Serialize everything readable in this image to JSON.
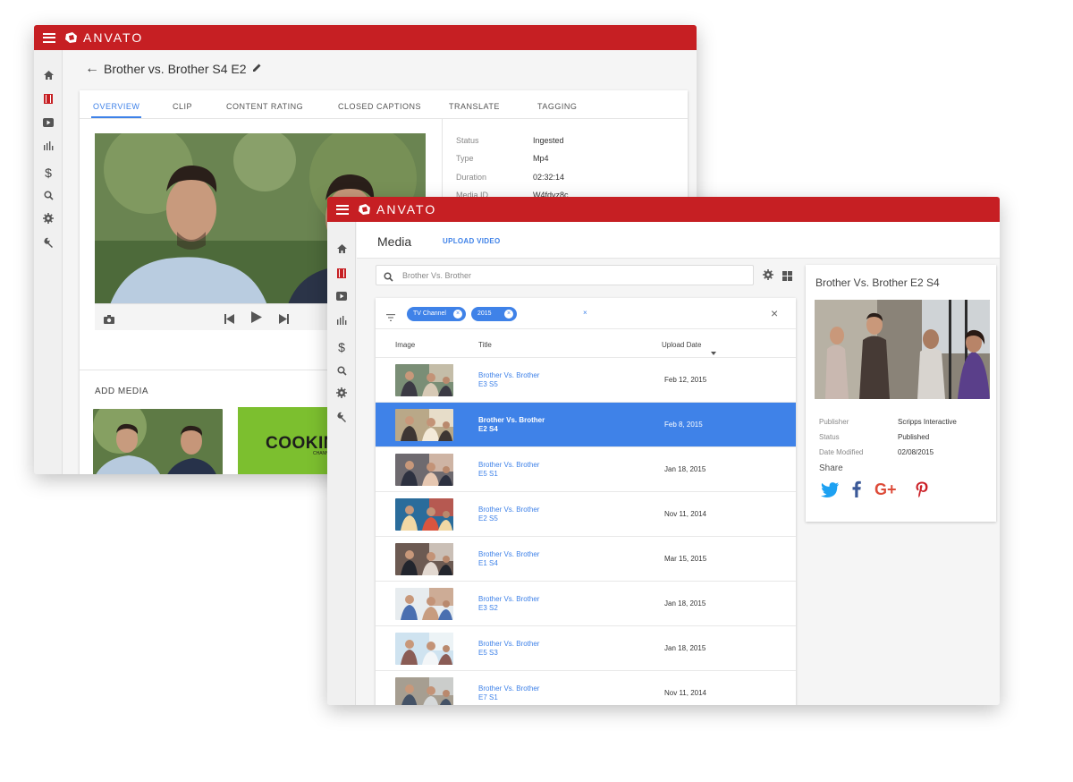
{
  "brand": {
    "name": "ANVATO",
    "color": "#c61f23",
    "accent": "#3f82e8"
  },
  "back_window": {
    "title": "Brother vs. Brother S4 E2",
    "tabs": [
      {
        "label": "OVERVIEW",
        "active": true
      },
      {
        "label": "CLIP"
      },
      {
        "label": "CONTENT RATING"
      },
      {
        "label": "CLOSED CAPTIONS"
      },
      {
        "label": "TRANSLATE"
      },
      {
        "label": "TAGGING"
      }
    ],
    "details": [
      {
        "label": "Status",
        "value": "Ingested"
      },
      {
        "label": "Type",
        "value": "Mp4"
      },
      {
        "label": "Duration",
        "value": "02:32:14"
      },
      {
        "label": "Media ID",
        "value": "W4fdvz8c"
      }
    ],
    "add_media_label": "ADD MEDIA",
    "promo_text": "COOKIN",
    "promo_sub": "CHANN"
  },
  "front_window": {
    "page_title": "Media",
    "upload_label": "UPLOAD VIDEO",
    "search_placeholder": "Brother Vs. Brother",
    "filters": [
      {
        "label": "TV Channel"
      },
      {
        "label": "2015"
      }
    ],
    "columns": {
      "image": "Image",
      "title": "Title",
      "upload_date": "Upload Date"
    },
    "rows": [
      {
        "title_line1": "Brother Vs. Brother",
        "title_line2": "E3 S5",
        "date": "Feb 12, 2015"
      },
      {
        "title_line1": "Brother Vs. Brother",
        "title_line2": "E2 S4",
        "date": "Feb 8, 2015",
        "selected": true
      },
      {
        "title_line1": "Brother Vs. Brother",
        "title_line2": "E5 S1",
        "date": "Jan 18, 2015"
      },
      {
        "title_line1": "Brother Vs. Brother",
        "title_line2": "E2 S5",
        "date": "Nov 11, 2014"
      },
      {
        "title_line1": "Brother Vs. Brother",
        "title_line2": "E1 S4",
        "date": "Mar 15, 2015"
      },
      {
        "title_line1": "Brother Vs. Brother",
        "title_line2": "E3 S2",
        "date": "Jan 18, 2015"
      },
      {
        "title_line1": "Brother Vs. Brother",
        "title_line2": "E5 S3",
        "date": "Jan 18, 2015"
      },
      {
        "title_line1": "Brother Vs. Brother",
        "title_line2": "E7 S1",
        "date": "Nov 11, 2014"
      }
    ],
    "detail": {
      "title": "Brother Vs. Brother E2 S4",
      "fields": [
        {
          "label": "Publisher",
          "value": "Scripps Interactive"
        },
        {
          "label": "Status",
          "value": "Published"
        },
        {
          "label": "Date Modified",
          "value": "02/08/2015"
        }
      ],
      "share_label": "Share",
      "social": [
        {
          "name": "twitter-icon",
          "color": "#1da1f2"
        },
        {
          "name": "facebook-icon",
          "color": "#3b5998"
        },
        {
          "name": "google-plus-icon",
          "color": "#dd4b39",
          "glyph": "G+"
        },
        {
          "name": "pinterest-icon",
          "color": "#cb2027"
        }
      ]
    }
  }
}
